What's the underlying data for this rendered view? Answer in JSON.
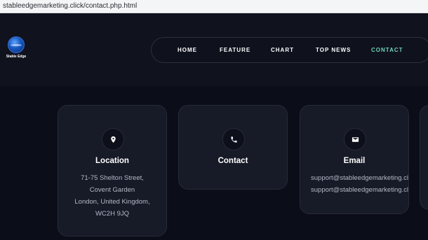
{
  "browser": {
    "url": "stableedgemarketing.click/contact.php.html"
  },
  "brand": {
    "name": "Stable Edge"
  },
  "nav": {
    "items": [
      {
        "label": "HOME"
      },
      {
        "label": "FEATURE"
      },
      {
        "label": "CHART"
      },
      {
        "label": "TOP NEWS"
      },
      {
        "label": "CONTACT"
      }
    ],
    "active_index": 4,
    "active_color": "#6ed3b8"
  },
  "cards": [
    {
      "icon": "map-pin-icon",
      "title": "Location",
      "lines": [
        "71-75 Shelton Street,",
        "Covent Garden",
        "London, United Kingdom,",
        "WC2H 9JQ"
      ]
    },
    {
      "icon": "phone-icon",
      "title": "Contact",
      "lines": []
    },
    {
      "icon": "envelope-icon",
      "title": "Email",
      "lines": [
        "support@stableedgemarketing.click",
        "support@stableedgemarketing.click"
      ]
    }
  ]
}
